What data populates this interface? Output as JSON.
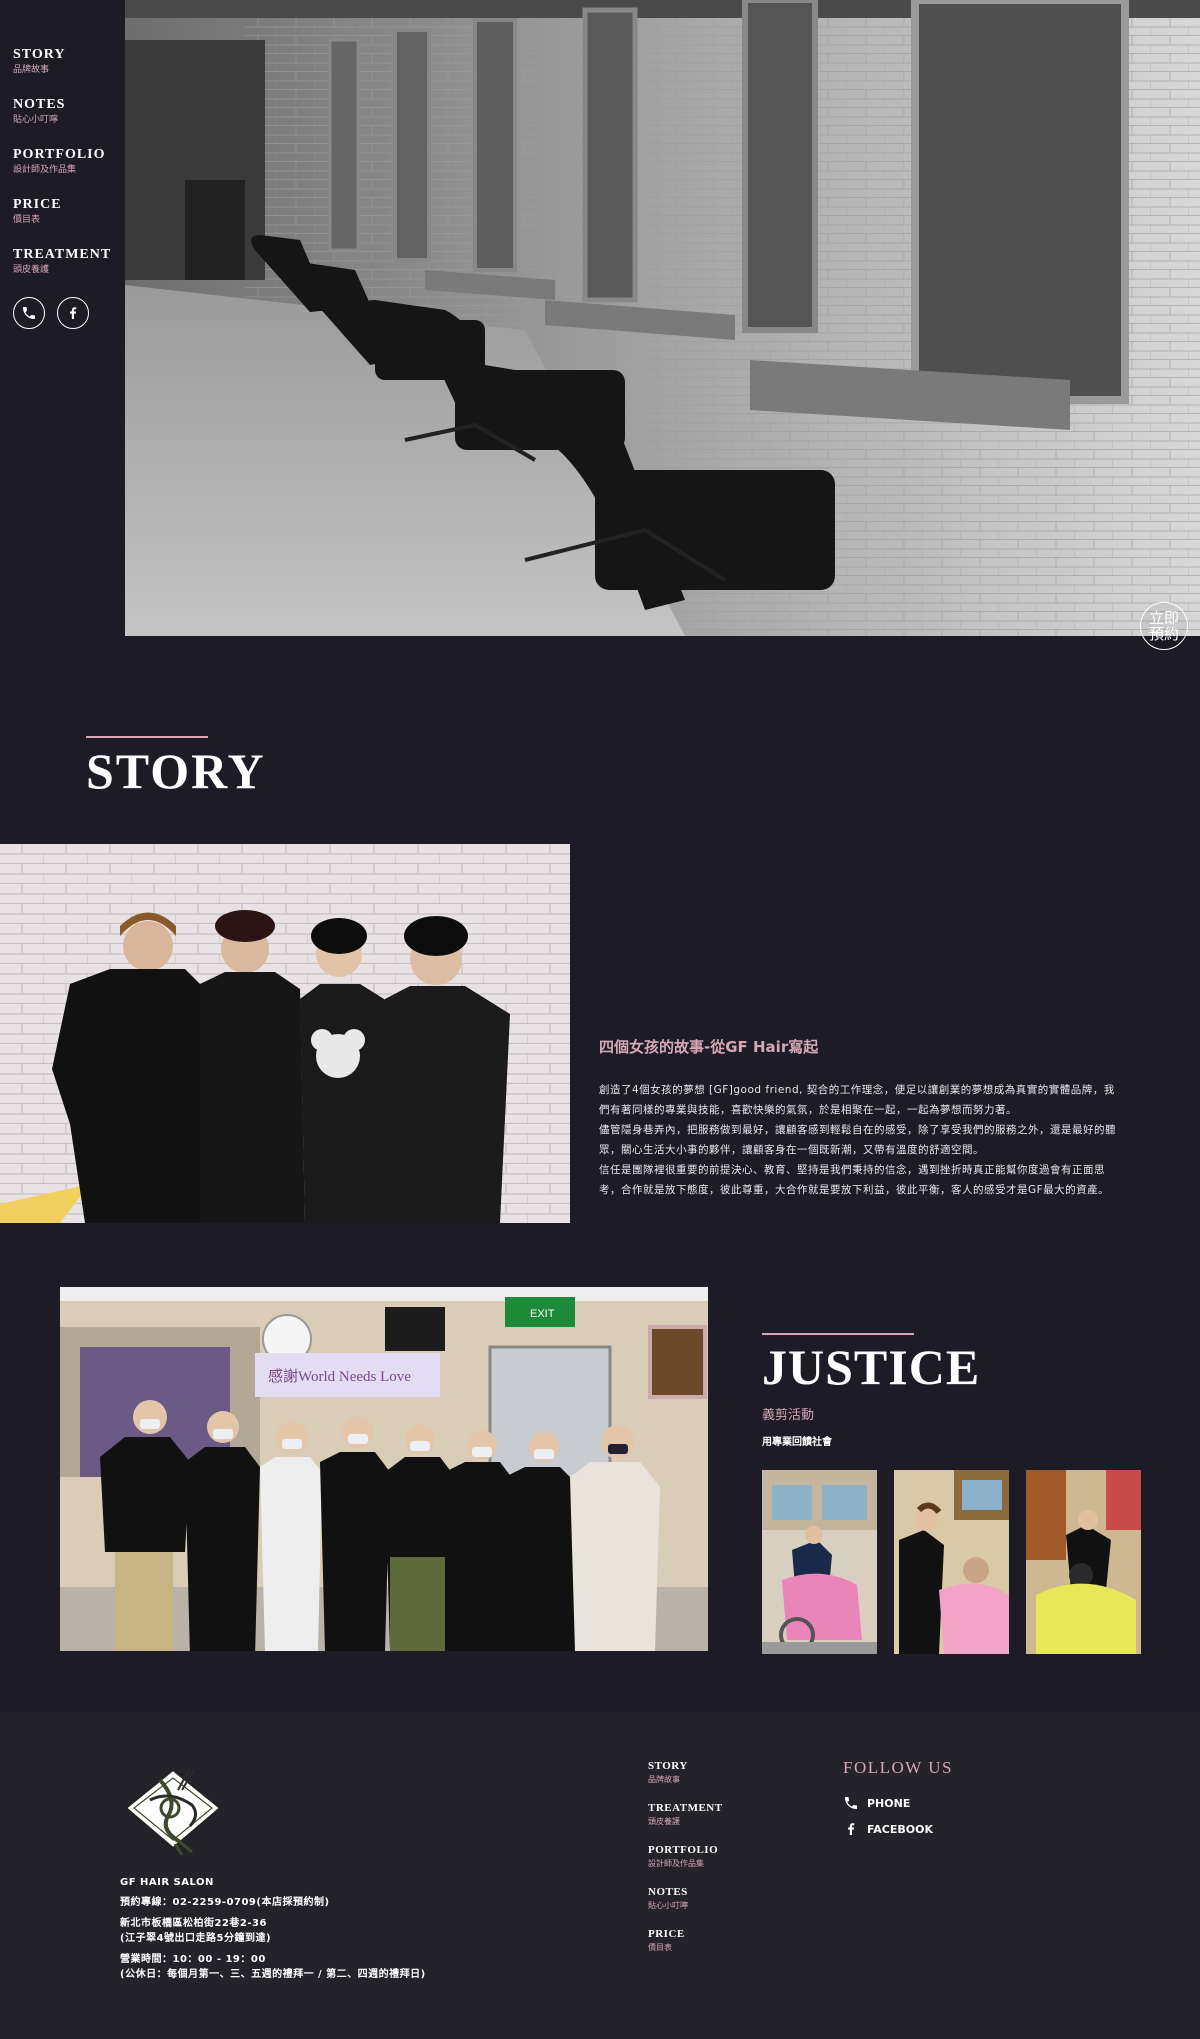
{
  "sidebar": {
    "items": [
      {
        "en": "STORY",
        "zh": "品牌故事"
      },
      {
        "en": "NOTES",
        "zh": "貼心小叮嚀"
      },
      {
        "en": "PORTFOLIO",
        "zh": "設計師及作品集"
      },
      {
        "en": "PRICE",
        "zh": "價目表"
      },
      {
        "en": "TREATMENT",
        "zh": "頭皮養護"
      }
    ],
    "icons": [
      "phone-icon",
      "facebook-icon"
    ]
  },
  "hero": {
    "reserve_line1": "立即",
    "reserve_line2": "預約"
  },
  "story": {
    "title": "STORY",
    "subtitle": "四個女孩的故事-從GF Hair寫起",
    "paragraphs": [
      "創造了4個女孩的夢想 [GF]good friend, 契合的工作理念，便足以讓創業的夢想成為真實的實體品牌，我們有著同樣的專業與技能，喜歡快樂的氣氛，於是相聚在一起，一起為夢想而努力著。",
      "儘管隱身巷弄內，把服務做到最好，讓顧客感到輕鬆自在的感受，除了享受我們的服務之外，還是最好的聽眾，關心生活大小事的夥伴，讓顧客身在一個既新潮，又帶有溫度的舒適空間。",
      "信任是團隊裡很重要的前提決心、教育、堅持是我們秉持的信念，遇到挫折時真正能幫你度過會有正面思考，合作就是放下態度，彼此尊重，大合作就是要放下利益，彼此平衡，客人的感受才是GF最大的資產。"
    ]
  },
  "justice": {
    "title": "JUSTICE",
    "subtitle": "義剪活動",
    "subtitle2": "用專業回饋社會",
    "banner_text": "感謝World Needs Love",
    "exit_sign": "EXIT"
  },
  "footer": {
    "salon_name": "GF HAIR SALON",
    "phone_line": "預約專線：02-2259-0709(本店採預約制)",
    "address1": "新北市板橋區松柏街22巷2-36",
    "address2": "(江子翠4號出口走路5分鐘到達)",
    "hours1": "營業時間：10：00 - 19：00",
    "hours2": "(公休日：每個月第一、三、五週的禮拜一 / 第二、四週的禮拜日)",
    "nav": [
      {
        "en": "STORY",
        "zh": "品牌故事"
      },
      {
        "en": "TREATMENT",
        "zh": "頭皮養護"
      },
      {
        "en": "PORTFOLIO",
        "zh": "設計師及作品集"
      },
      {
        "en": "NOTES",
        "zh": "貼心小叮嚀"
      },
      {
        "en": "PRICE",
        "zh": "價目表"
      }
    ],
    "follow_title": "FOLLOW US",
    "phone_label": "PHONE",
    "facebook_label": "FACEBOOK"
  },
  "colors": {
    "background": "#1c1b26",
    "footer": "#24232a",
    "accent": "#d6a8b4"
  }
}
